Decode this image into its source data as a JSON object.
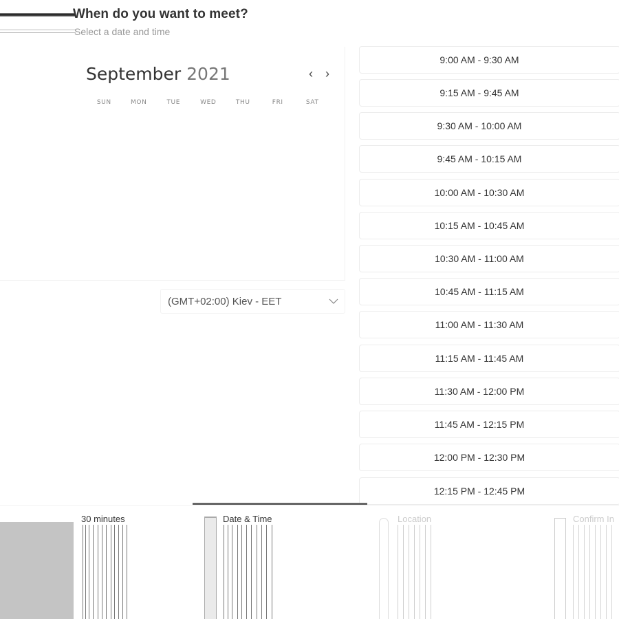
{
  "header": {
    "title": "When do you want to meet?",
    "subtitle": "Select a date and time"
  },
  "calendar": {
    "month": "September",
    "year": "2021",
    "prev_icon": "chevron-left-icon",
    "next_icon": "chevron-right-icon",
    "weekdays": [
      "SUN",
      "MON",
      "TUE",
      "WED",
      "THU",
      "FRI",
      "SAT"
    ]
  },
  "timezone": {
    "selected": "(GMT+02:00) Kiev - EET",
    "icon": "chevron-down-icon"
  },
  "time_slots": [
    "9:00 AM - 9:30 AM",
    "9:15 AM - 9:45 AM",
    "9:30 AM - 10:00 AM",
    "9:45 AM - 10:15 AM",
    "10:00 AM - 10:30 AM",
    "10:15 AM - 10:45 AM",
    "10:30 AM - 11:00 AM",
    "10:45 AM - 11:15 AM",
    "11:00 AM - 11:30 AM",
    "11:15 AM - 11:45 AM",
    "11:30 AM - 12:00 PM",
    "11:45 AM - 12:15 PM",
    "12:00 PM - 12:30 PM",
    "12:15 PM - 12:45 PM"
  ],
  "steps": [
    {
      "label": "30 minutes"
    },
    {
      "label": "Date & Time",
      "icon": "calendar-icon"
    },
    {
      "label": "Location",
      "icon": "location-pin-icon"
    },
    {
      "label": "Confirm In",
      "icon": "checkbox-icon"
    }
  ],
  "colors": {
    "progress": "#666666",
    "border": "#ececec"
  }
}
